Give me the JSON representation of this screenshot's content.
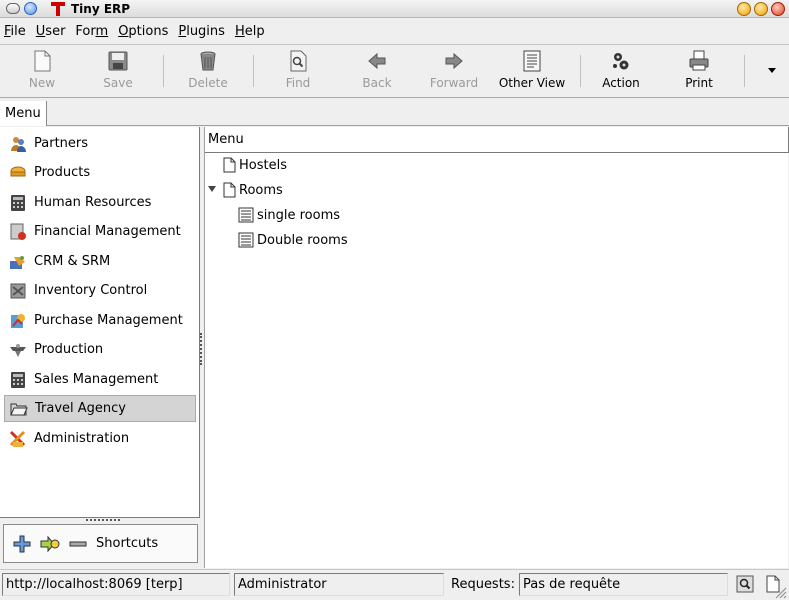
{
  "window": {
    "title": "Tiny ERP"
  },
  "menubar": [
    {
      "pre": "",
      "u": "F",
      "post": "ile"
    },
    {
      "pre": "",
      "u": "U",
      "post": "ser"
    },
    {
      "pre": "For",
      "u": "m",
      "post": ""
    },
    {
      "pre": "",
      "u": "O",
      "post": "ptions"
    },
    {
      "pre": "",
      "u": "P",
      "post": "lugins"
    },
    {
      "pre": "",
      "u": "H",
      "post": "elp"
    }
  ],
  "toolbar": {
    "new": "New",
    "save": "Save",
    "delete": "Delete",
    "find": "Find",
    "back": "Back",
    "forward": "Forward",
    "other_view": "Other View",
    "action": "Action",
    "print": "Print"
  },
  "tab": {
    "label": "Menu"
  },
  "sidebar": {
    "items": [
      {
        "label": "Partners",
        "icon": "partners-icon"
      },
      {
        "label": "Products",
        "icon": "products-icon"
      },
      {
        "label": "Human Resources",
        "icon": "calculator-icon"
      },
      {
        "label": "Financial Management",
        "icon": "finance-icon"
      },
      {
        "label": "CRM & SRM",
        "icon": "crm-icon"
      },
      {
        "label": "Inventory Control",
        "icon": "inventory-icon"
      },
      {
        "label": "Purchase Management",
        "icon": "purchase-icon"
      },
      {
        "label": "Production",
        "icon": "production-icon"
      },
      {
        "label": "Sales Management",
        "icon": "calculator-icon"
      },
      {
        "label": "Travel Agency",
        "icon": "folder-open-icon",
        "selected": true
      },
      {
        "label": "Administration",
        "icon": "administration-icon"
      }
    ]
  },
  "shortcuts": {
    "label": "Shortcuts"
  },
  "tree": {
    "header": "Menu",
    "nodes": [
      {
        "label": "Hostels"
      },
      {
        "label": "Rooms",
        "expanded": true
      },
      {
        "label": "single rooms"
      },
      {
        "label": "Double rooms"
      }
    ]
  },
  "status": {
    "server": "http://localhost:8069 [terp]",
    "user": "Administrator",
    "requests_label": "Requests:",
    "requests_value": "Pas de requête"
  },
  "colors": {
    "selection": "#d4d4d4",
    "close_button": "#e04020",
    "min_max_button": "#f0a000",
    "logo": "#cc0000"
  }
}
